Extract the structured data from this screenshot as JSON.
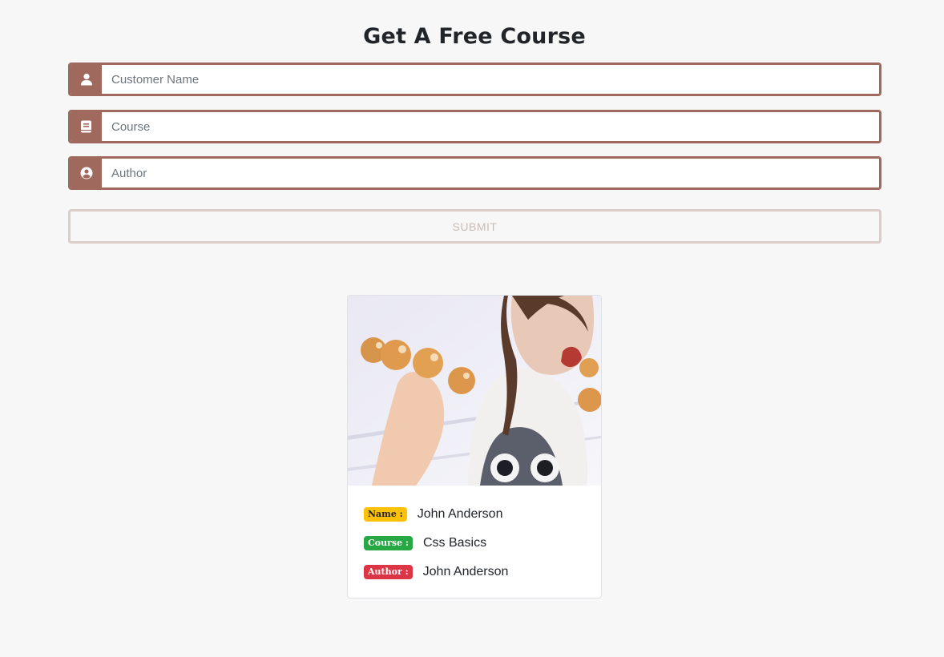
{
  "title": "Get A Free Course",
  "form": {
    "customer_placeholder": "Customer Name",
    "course_placeholder": "Course",
    "author_placeholder": "Author",
    "submit_label": "SUBMIT"
  },
  "icons": {
    "customer": "user-icon",
    "course": "book-icon",
    "author": "user-circle-icon"
  },
  "colors": {
    "accent": "#a0695e",
    "name_badge": "#ffc107",
    "course_badge": "#28a745",
    "author_badge": "#dc3545"
  },
  "card": {
    "name_label": "Name :",
    "name_value": "John Anderson",
    "course_label": "Course :",
    "course_value": "Css Basics",
    "author_label": "Author :",
    "author_value": "John Anderson"
  }
}
